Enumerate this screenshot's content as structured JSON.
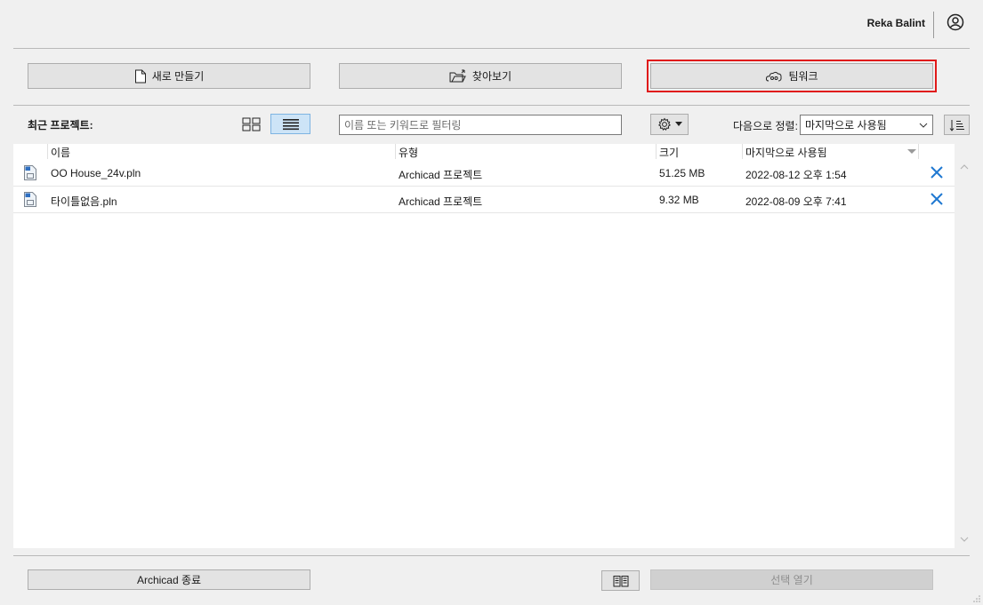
{
  "header": {
    "user_name": "Reka Balint",
    "user_icon": "user-circle-icon"
  },
  "actions": {
    "new_label": "새로 만들기",
    "browse_label": "찾아보기",
    "teamwork_label": "팀워크"
  },
  "recent": {
    "title": "최근 프로젝트:",
    "filter_placeholder": "이름 또는 키워드로 필터링",
    "sort_label": "다음으로 정렬:",
    "sort_value": "마지막으로 사용됨"
  },
  "table": {
    "columns": [
      "이름",
      "유형",
      "크기",
      "마지막으로 사용됨"
    ],
    "rows": [
      {
        "name": "OO House_24v.pln",
        "type": "Archicad 프로젝트",
        "size": "51.25 MB",
        "last_used": "2022-08-12 오후 1:54"
      },
      {
        "name": "타이틀없음.pln",
        "type": "Archicad 프로젝트",
        "size": "9.32 MB",
        "last_used": "2022-08-09 오후 7:41"
      }
    ]
  },
  "footer": {
    "quit_label": "Archicad 종료",
    "open_label": "선택 열기"
  },
  "colors": {
    "accent": "#1f78d1",
    "highlight": "#e01a1a",
    "active_view": "#cde4f7"
  }
}
